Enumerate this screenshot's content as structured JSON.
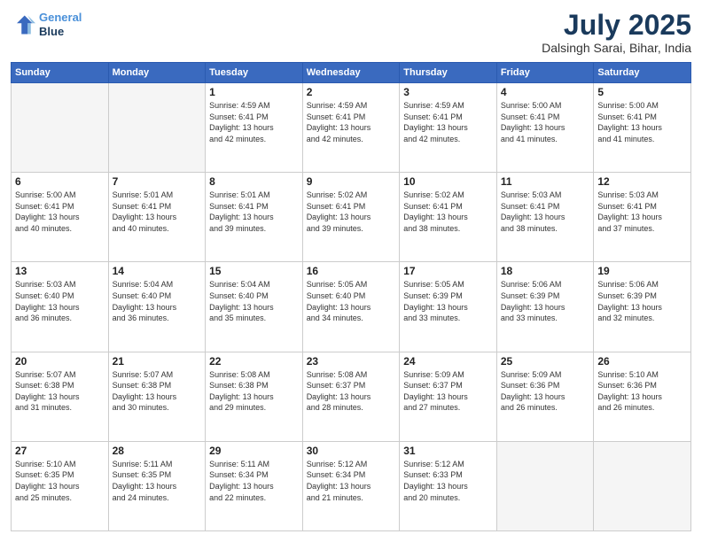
{
  "header": {
    "logo_line1": "General",
    "logo_line2": "Blue",
    "month": "July 2025",
    "location": "Dalsingh Sarai, Bihar, India"
  },
  "weekdays": [
    "Sunday",
    "Monday",
    "Tuesday",
    "Wednesday",
    "Thursday",
    "Friday",
    "Saturday"
  ],
  "weeks": [
    [
      {
        "day": "",
        "info": ""
      },
      {
        "day": "",
        "info": ""
      },
      {
        "day": "1",
        "info": "Sunrise: 4:59 AM\nSunset: 6:41 PM\nDaylight: 13 hours\nand 42 minutes."
      },
      {
        "day": "2",
        "info": "Sunrise: 4:59 AM\nSunset: 6:41 PM\nDaylight: 13 hours\nand 42 minutes."
      },
      {
        "day": "3",
        "info": "Sunrise: 4:59 AM\nSunset: 6:41 PM\nDaylight: 13 hours\nand 42 minutes."
      },
      {
        "day": "4",
        "info": "Sunrise: 5:00 AM\nSunset: 6:41 PM\nDaylight: 13 hours\nand 41 minutes."
      },
      {
        "day": "5",
        "info": "Sunrise: 5:00 AM\nSunset: 6:41 PM\nDaylight: 13 hours\nand 41 minutes."
      }
    ],
    [
      {
        "day": "6",
        "info": "Sunrise: 5:00 AM\nSunset: 6:41 PM\nDaylight: 13 hours\nand 40 minutes."
      },
      {
        "day": "7",
        "info": "Sunrise: 5:01 AM\nSunset: 6:41 PM\nDaylight: 13 hours\nand 40 minutes."
      },
      {
        "day": "8",
        "info": "Sunrise: 5:01 AM\nSunset: 6:41 PM\nDaylight: 13 hours\nand 39 minutes."
      },
      {
        "day": "9",
        "info": "Sunrise: 5:02 AM\nSunset: 6:41 PM\nDaylight: 13 hours\nand 39 minutes."
      },
      {
        "day": "10",
        "info": "Sunrise: 5:02 AM\nSunset: 6:41 PM\nDaylight: 13 hours\nand 38 minutes."
      },
      {
        "day": "11",
        "info": "Sunrise: 5:03 AM\nSunset: 6:41 PM\nDaylight: 13 hours\nand 38 minutes."
      },
      {
        "day": "12",
        "info": "Sunrise: 5:03 AM\nSunset: 6:41 PM\nDaylight: 13 hours\nand 37 minutes."
      }
    ],
    [
      {
        "day": "13",
        "info": "Sunrise: 5:03 AM\nSunset: 6:40 PM\nDaylight: 13 hours\nand 36 minutes."
      },
      {
        "day": "14",
        "info": "Sunrise: 5:04 AM\nSunset: 6:40 PM\nDaylight: 13 hours\nand 36 minutes."
      },
      {
        "day": "15",
        "info": "Sunrise: 5:04 AM\nSunset: 6:40 PM\nDaylight: 13 hours\nand 35 minutes."
      },
      {
        "day": "16",
        "info": "Sunrise: 5:05 AM\nSunset: 6:40 PM\nDaylight: 13 hours\nand 34 minutes."
      },
      {
        "day": "17",
        "info": "Sunrise: 5:05 AM\nSunset: 6:39 PM\nDaylight: 13 hours\nand 33 minutes."
      },
      {
        "day": "18",
        "info": "Sunrise: 5:06 AM\nSunset: 6:39 PM\nDaylight: 13 hours\nand 33 minutes."
      },
      {
        "day": "19",
        "info": "Sunrise: 5:06 AM\nSunset: 6:39 PM\nDaylight: 13 hours\nand 32 minutes."
      }
    ],
    [
      {
        "day": "20",
        "info": "Sunrise: 5:07 AM\nSunset: 6:38 PM\nDaylight: 13 hours\nand 31 minutes."
      },
      {
        "day": "21",
        "info": "Sunrise: 5:07 AM\nSunset: 6:38 PM\nDaylight: 13 hours\nand 30 minutes."
      },
      {
        "day": "22",
        "info": "Sunrise: 5:08 AM\nSunset: 6:38 PM\nDaylight: 13 hours\nand 29 minutes."
      },
      {
        "day": "23",
        "info": "Sunrise: 5:08 AM\nSunset: 6:37 PM\nDaylight: 13 hours\nand 28 minutes."
      },
      {
        "day": "24",
        "info": "Sunrise: 5:09 AM\nSunset: 6:37 PM\nDaylight: 13 hours\nand 27 minutes."
      },
      {
        "day": "25",
        "info": "Sunrise: 5:09 AM\nSunset: 6:36 PM\nDaylight: 13 hours\nand 26 minutes."
      },
      {
        "day": "26",
        "info": "Sunrise: 5:10 AM\nSunset: 6:36 PM\nDaylight: 13 hours\nand 26 minutes."
      }
    ],
    [
      {
        "day": "27",
        "info": "Sunrise: 5:10 AM\nSunset: 6:35 PM\nDaylight: 13 hours\nand 25 minutes."
      },
      {
        "day": "28",
        "info": "Sunrise: 5:11 AM\nSunset: 6:35 PM\nDaylight: 13 hours\nand 24 minutes."
      },
      {
        "day": "29",
        "info": "Sunrise: 5:11 AM\nSunset: 6:34 PM\nDaylight: 13 hours\nand 22 minutes."
      },
      {
        "day": "30",
        "info": "Sunrise: 5:12 AM\nSunset: 6:34 PM\nDaylight: 13 hours\nand 21 minutes."
      },
      {
        "day": "31",
        "info": "Sunrise: 5:12 AM\nSunset: 6:33 PM\nDaylight: 13 hours\nand 20 minutes."
      },
      {
        "day": "",
        "info": ""
      },
      {
        "day": "",
        "info": ""
      }
    ]
  ]
}
